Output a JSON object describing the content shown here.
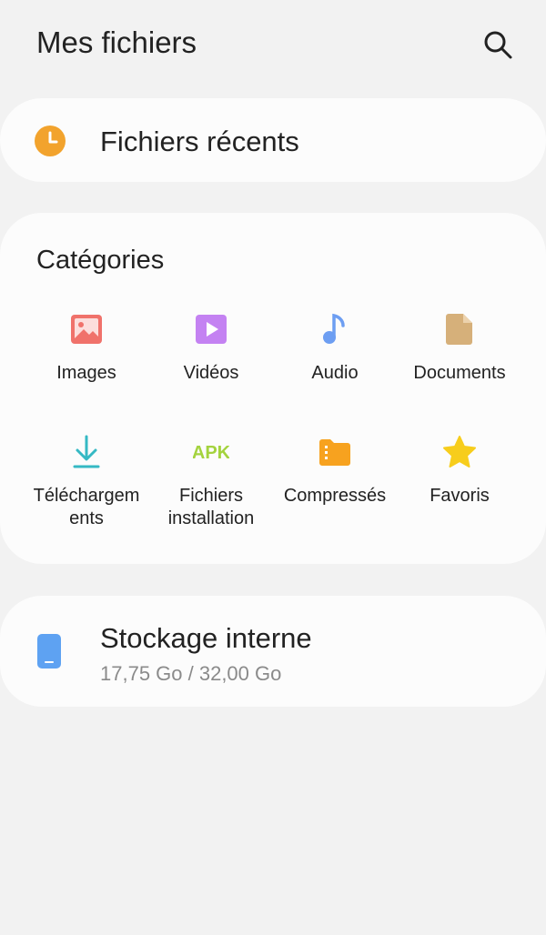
{
  "header": {
    "title": "Mes fichiers",
    "search_icon": "search-icon"
  },
  "recent": {
    "label": "Fichiers récents",
    "icon": "clock-icon",
    "icon_color": "#f2a32d"
  },
  "categories": {
    "title": "Catégories",
    "items": [
      {
        "label": "Images",
        "icon": "image-icon",
        "color": "#f0726b"
      },
      {
        "label": "Vidéos",
        "icon": "video-icon",
        "color": "#c482f2"
      },
      {
        "label": "Audio",
        "icon": "music-note-icon",
        "color": "#6d9ef2"
      },
      {
        "label": "Documents",
        "icon": "document-icon",
        "color": "#d6b07a"
      },
      {
        "label": "Téléchargem ents",
        "icon": "download-icon",
        "color": "#35b9c4"
      },
      {
        "label": "Fichiers installation",
        "icon": "apk-icon",
        "icon_text": "APK",
        "color": "#a4d33e"
      },
      {
        "label": "Compressés",
        "icon": "compressed-folder-icon",
        "color": "#f7a21f"
      },
      {
        "label": "Favoris",
        "icon": "star-icon",
        "color": "#f7cd1c"
      }
    ]
  },
  "storage": {
    "title": "Stockage interne",
    "usage": "17,75 Go / 32,00 Go",
    "icon": "phone-icon",
    "icon_color": "#5ea2f2"
  }
}
